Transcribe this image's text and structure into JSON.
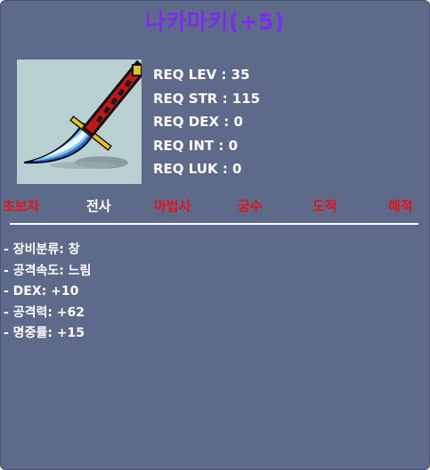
{
  "item": {
    "name": "나카마키(+5)",
    "name_color": "#7b2cf0",
    "icon": "curved-dagger-icon"
  },
  "requirements": [
    "REQ LEV : 35",
    "REQ STR : 115",
    "REQ DEX : 0",
    "REQ INT : 0",
    "REQ LUK : 0"
  ],
  "jobs": [
    {
      "label": "초보자",
      "usable": false
    },
    {
      "label": "전사",
      "usable": true
    },
    {
      "label": "마법사",
      "usable": false
    },
    {
      "label": "궁수",
      "usable": false
    },
    {
      "label": "도적",
      "usable": false
    },
    {
      "label": "해적",
      "usable": false
    }
  ],
  "colors": {
    "background": "#5e6a8a",
    "job_disabled": "#e8101a",
    "job_enabled": "#ffffff"
  },
  "stats": [
    "- 장비분류: 창",
    "- 공격속도: 느림",
    "- DEX: +10",
    "- 공격력: +62",
    "- 명중률: +15"
  ]
}
